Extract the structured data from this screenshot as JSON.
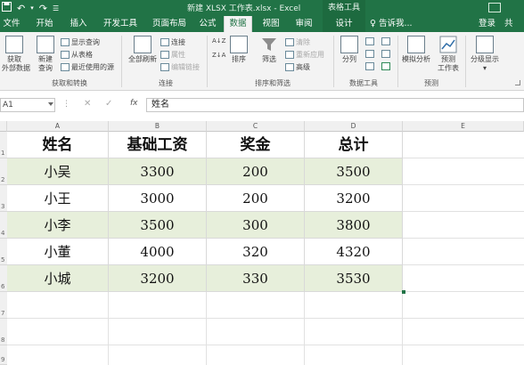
{
  "app": {
    "title": "新建 XLSX 工作表.xlsx - Excel",
    "context_title": "表格工具",
    "qat_icons": [
      "save-icon",
      "undo-icon",
      "redo-icon",
      "customize-qat-icon"
    ]
  },
  "tabs": [
    {
      "label": "文件"
    },
    {
      "label": "开始"
    },
    {
      "label": "插入"
    },
    {
      "label": "开发工具"
    },
    {
      "label": "页面布局"
    },
    {
      "label": "公式"
    },
    {
      "label": "数据",
      "active": true
    },
    {
      "label": "视图"
    },
    {
      "label": "审阅"
    },
    {
      "label": "设计",
      "context": true
    }
  ],
  "tell_me": "告诉我...",
  "login": "登录",
  "share": "共",
  "ribbon": {
    "get_data": {
      "line1": "获取",
      "line2": "外部数据"
    },
    "new_query": {
      "line1": "新建",
      "line2": "查询"
    },
    "show_queries": "显示查询",
    "from_table": "从表格",
    "recent_sources": "最近使用的源",
    "group_get_transform": "获取和转换",
    "refresh_all": "全部刷新",
    "connections": "连接",
    "properties": "属性",
    "edit_links": "编辑链接",
    "group_connections": "连接",
    "sort": "排序",
    "filter": "筛选",
    "clear": "清除",
    "reapply": "重新应用",
    "advanced": "高级",
    "group_sort_filter": "排序和筛选",
    "text_to_columns": "分列",
    "group_data_tools": "数据工具",
    "what_if": "模拟分析",
    "forecast_sheet": {
      "line1": "预测",
      "line2": "工作表"
    },
    "group_forecast": "预测",
    "outline": "分级显示",
    "sort_az": "A↓Z",
    "sort_za": "Z↓A"
  },
  "formula_bar": {
    "name_box": "A1",
    "cancel": "✕",
    "enter": "✓",
    "fx": "fx",
    "content": "姓名"
  },
  "columns": [
    "A",
    "B",
    "C",
    "D",
    "E"
  ],
  "rows": [
    "1",
    "2",
    "3",
    "4",
    "5",
    "6",
    "7",
    "8",
    "9"
  ],
  "table": {
    "headers": [
      "姓名",
      "基础工资",
      "奖金",
      "总计"
    ],
    "rows": [
      [
        "小吴",
        "3300",
        "200",
        "3500"
      ],
      [
        "小王",
        "3000",
        "200",
        "3200"
      ],
      [
        "小李",
        "3500",
        "300",
        "3800"
      ],
      [
        "小董",
        "4000",
        "320",
        "4320"
      ],
      [
        "小城",
        "3200",
        "330",
        "3530"
      ]
    ],
    "band_color": "#e7efdb"
  },
  "colors": {
    "excel_green": "#217346",
    "band_green": "#e7efdb"
  }
}
